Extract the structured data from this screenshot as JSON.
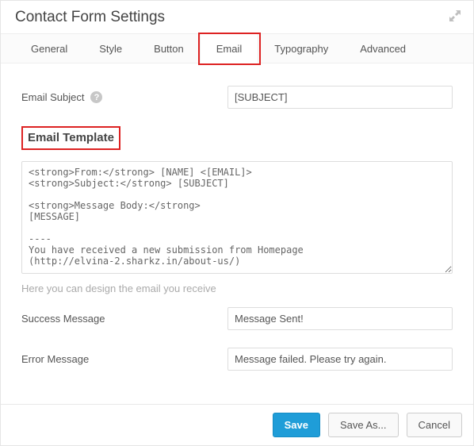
{
  "header": {
    "title": "Contact Form Settings"
  },
  "tabs": {
    "t0": "General",
    "t1": "Style",
    "t2": "Button",
    "t3": "Email",
    "t4": "Typography",
    "t5": "Advanced"
  },
  "email_subject": {
    "label": "Email Subject",
    "value": "[SUBJECT]"
  },
  "template": {
    "title": "Email Template",
    "value": "<strong>From:</strong> [NAME] <[EMAIL]>\n<strong>Subject:</strong> [SUBJECT]\n\n<strong>Message Body:</strong>\n[MESSAGE]\n\n----\nYou have received a new submission from Homepage\n(http://elvina-2.sharkz.in/about-us/)",
    "hint": "Here you can design the email you receive"
  },
  "success": {
    "label": "Success Message",
    "value": "Message Sent!"
  },
  "error": {
    "label": "Error Message",
    "value": "Message failed. Please try again."
  },
  "footer": {
    "save": "Save",
    "saveas": "Save As...",
    "cancel": "Cancel"
  }
}
